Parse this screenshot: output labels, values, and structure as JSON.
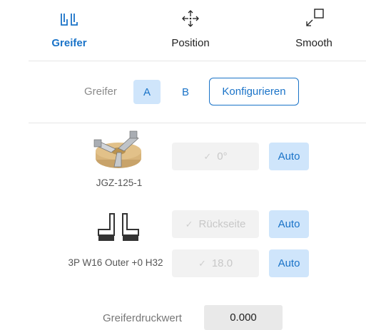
{
  "tabs": [
    {
      "label": "Greifer",
      "icon": "gripper-icon",
      "active": true
    },
    {
      "label": "Position",
      "icon": "move-arrows-icon",
      "active": false
    },
    {
      "label": "Smooth",
      "icon": "smooth-resize-icon",
      "active": false
    }
  ],
  "gripper_select": {
    "label": "Greifer",
    "option_a": "A",
    "option_b": "B",
    "configure_label": "Konfigurieren"
  },
  "gripper_model": {
    "name": "JGZ-125-1",
    "rotation_value": "0°",
    "auto_label": "Auto"
  },
  "jaw_config": {
    "name": "3P W16 Outer +0 H32",
    "side_value": "Rückseite",
    "side_auto_label": "Auto",
    "height_value": "18.0",
    "height_auto_label": "Auto"
  },
  "pressure": {
    "label": "Greiferdruckwert",
    "value": "0.000"
  },
  "colors": {
    "accent": "#1a73c8",
    "accent_light": "#cfe5fb"
  }
}
